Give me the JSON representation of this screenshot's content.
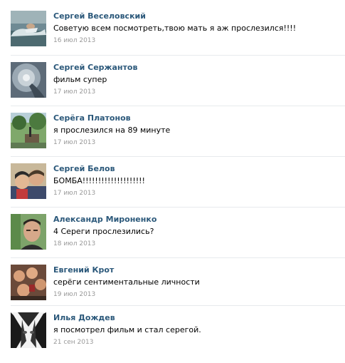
{
  "comments": [
    {
      "author": "Сергей Веселовский",
      "text": "Советую всем посмотреть,твою мать я аж прослезился!!!!",
      "date": "16 июл 2013",
      "avatar": "avatar-swimmer"
    },
    {
      "author": "Сергей Сержантов",
      "text": "фильм супер",
      "date": "17 июл 2013",
      "avatar": "avatar-tunnel"
    },
    {
      "author": "Серёга Платонов",
      "text": "я прослезился на 89 минуте",
      "date": "17 июл 2013",
      "avatar": "avatar-park"
    },
    {
      "author": "Сергей Белов",
      "text": "БОМБА!!!!!!!!!!!!!!!!!!!!",
      "date": "17 июл 2013",
      "avatar": "avatar-father-son"
    },
    {
      "author": "Александр Мироненко",
      "text": "4 Сереги прослезились?",
      "date": "18 июл 2013",
      "avatar": "avatar-man-portrait"
    },
    {
      "author": "Евгений Крот",
      "text": "серёги сентиментальные личности",
      "date": "19 июл 2013",
      "avatar": "avatar-group"
    },
    {
      "author": "Илья Дождев",
      "text": "я посмотрел фильм и стал серегой.",
      "date": "21 сен 2013",
      "avatar": "avatar-anime"
    }
  ],
  "colors": {
    "author": "#2b587a",
    "text": "#000000",
    "date": "#999999",
    "divider": "#e7eaed"
  }
}
